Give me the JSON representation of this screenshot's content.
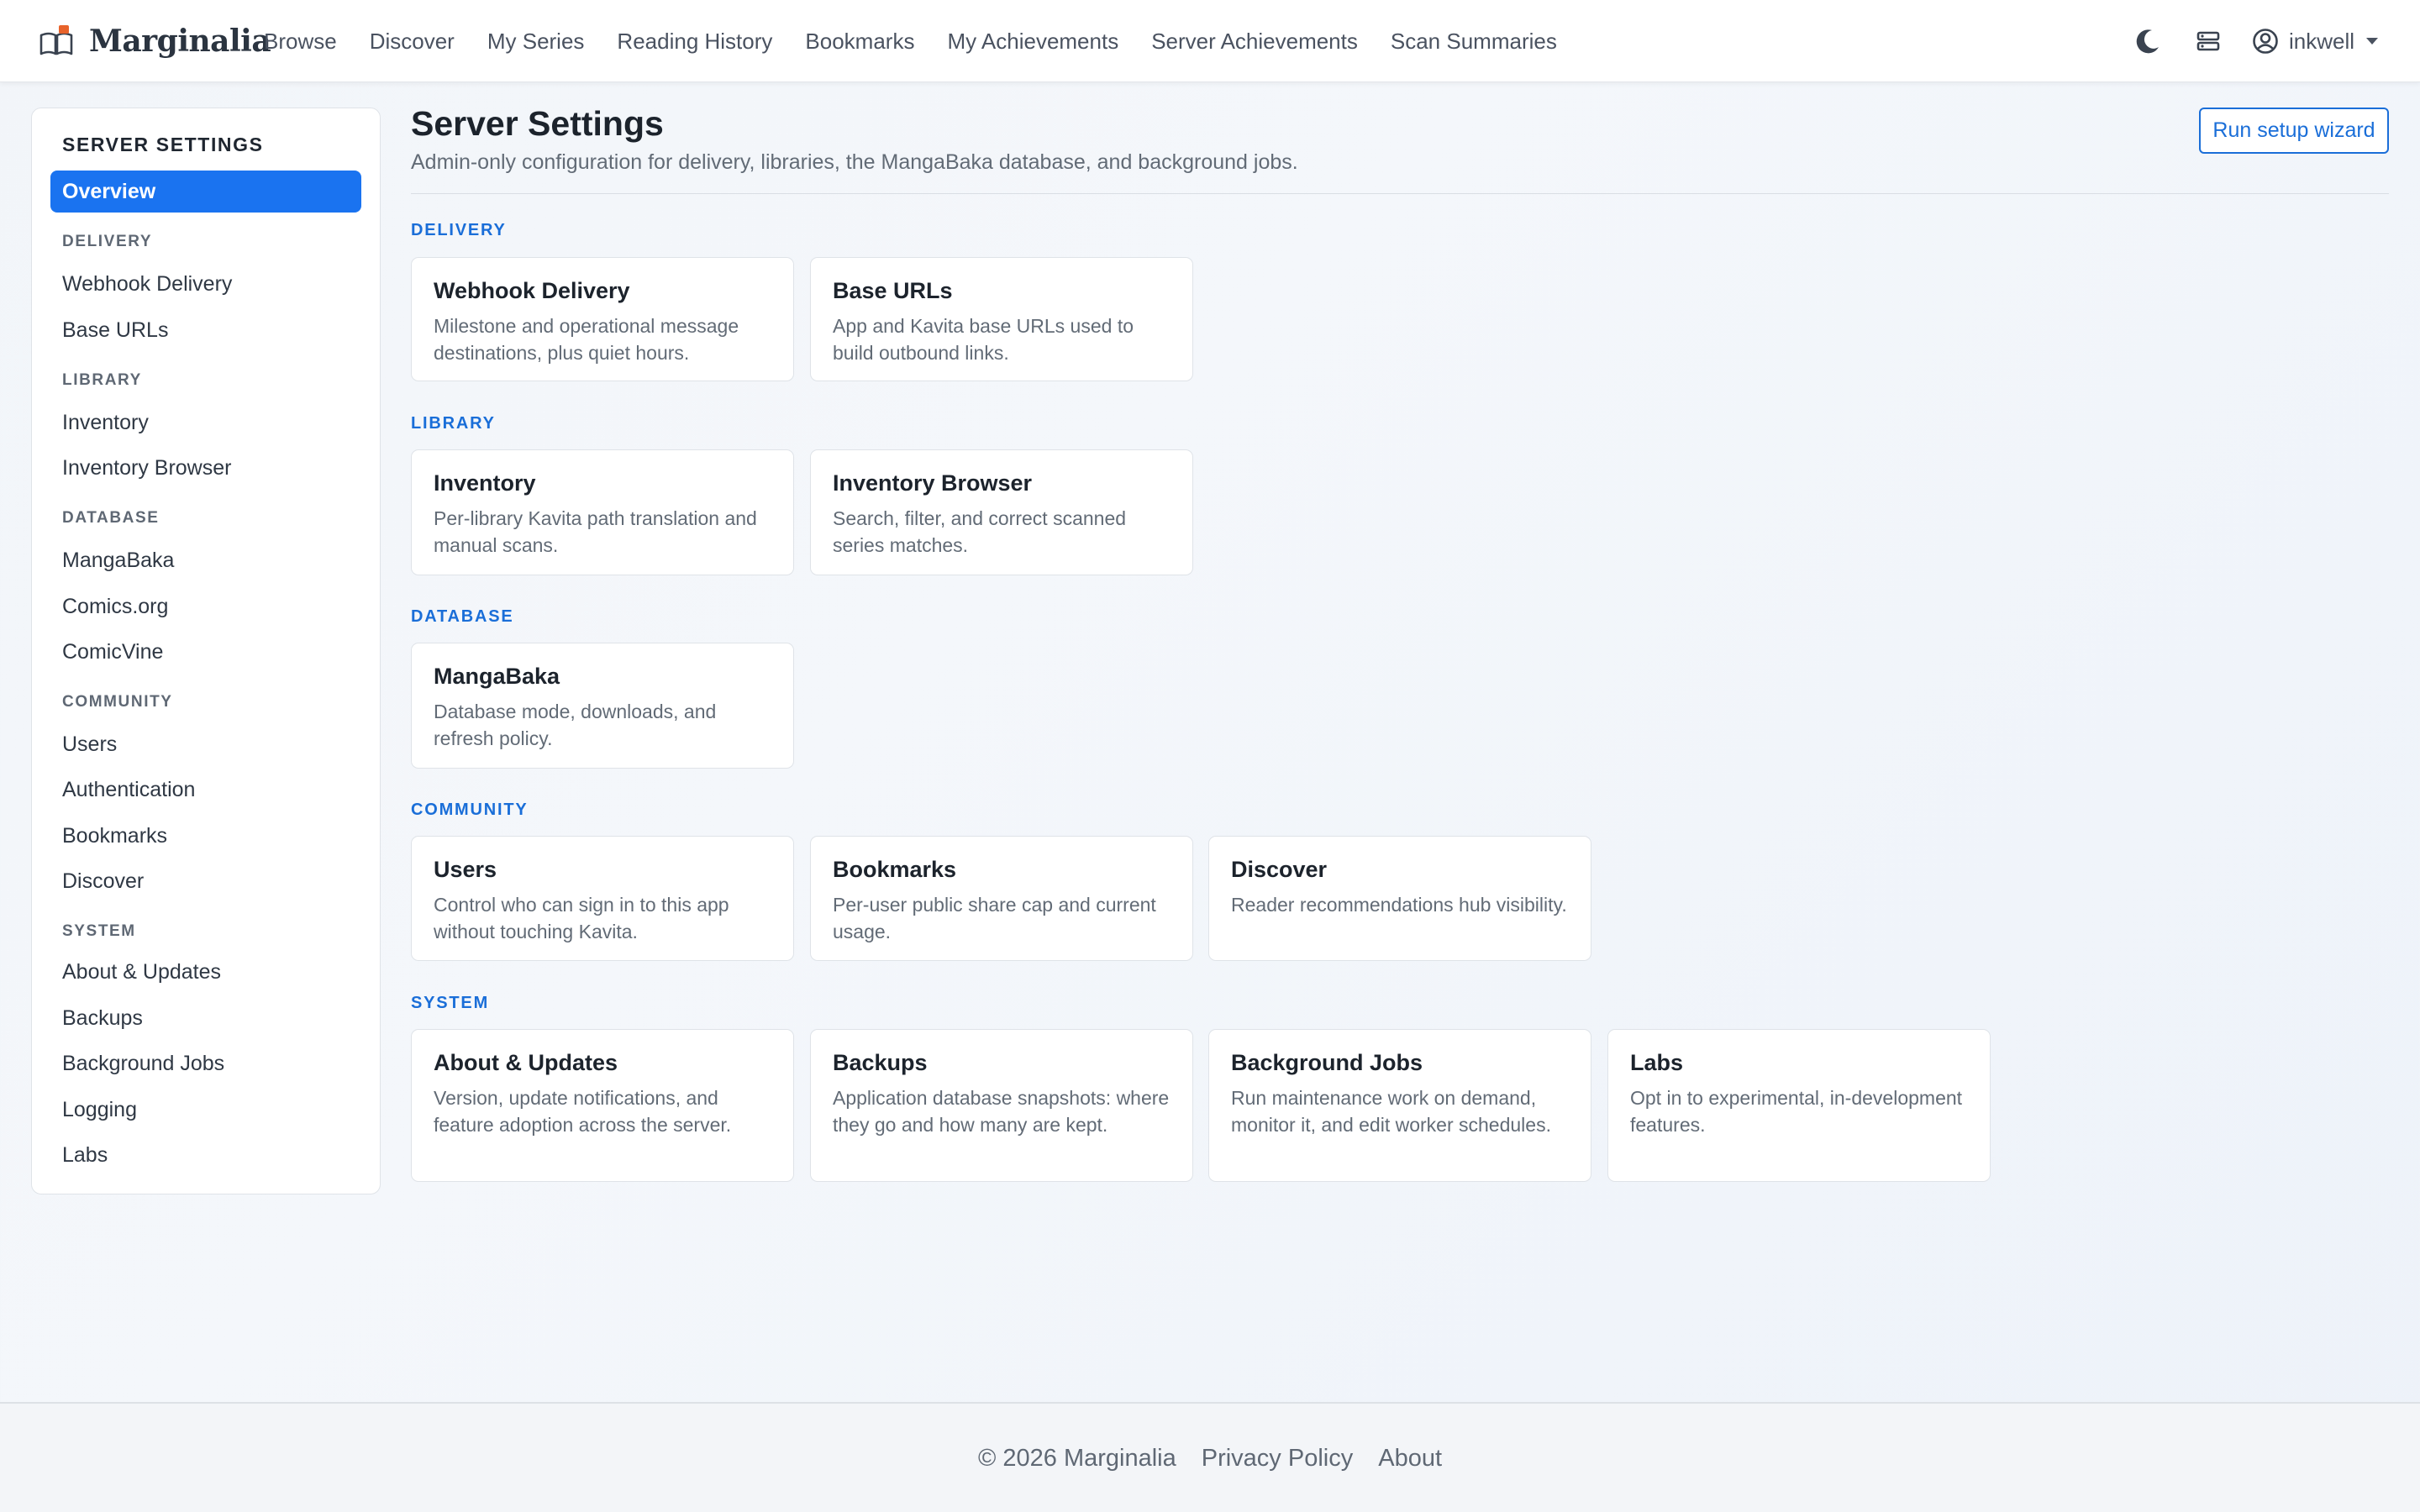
{
  "brand": {
    "name": "Marginalia",
    "icon": "open-book-icon",
    "accent": "#e8632b"
  },
  "nav": {
    "links": [
      "Browse",
      "Discover",
      "My Series",
      "Reading History",
      "Bookmarks",
      "My Achievements",
      "Server Achievements",
      "Scan Summaries"
    ],
    "theme_icon": "moon-icon",
    "server_icon": "server-icon",
    "user": {
      "icon": "user-circle-icon",
      "name": "inkwell"
    }
  },
  "sidebar": {
    "title": "SERVER SETTINGS",
    "active": "Overview",
    "groups": [
      {
        "label": "DELIVERY",
        "items": [
          "Webhook Delivery",
          "Base URLs"
        ]
      },
      {
        "label": "LIBRARY",
        "items": [
          "Inventory",
          "Inventory Browser"
        ]
      },
      {
        "label": "DATABASE",
        "items": [
          "MangaBaka",
          "Comics.org",
          "ComicVine"
        ]
      },
      {
        "label": "COMMUNITY",
        "items": [
          "Users",
          "Authentication",
          "Bookmarks",
          "Discover"
        ]
      },
      {
        "label": "SYSTEM",
        "items": [
          "About & Updates",
          "Backups",
          "Background Jobs",
          "Logging",
          "Labs"
        ]
      }
    ]
  },
  "main": {
    "title": "Server Settings",
    "subtitle": "Admin-only configuration for delivery, libraries, the MangaBaka database, and background jobs.",
    "wizard_button": "Run setup wizard",
    "sections": [
      {
        "label": "DELIVERY",
        "cards": [
          {
            "title": "Webhook Delivery",
            "desc": "Milestone and operational message destinations, plus quiet hours."
          },
          {
            "title": "Base URLs",
            "desc": "App and Kavita base URLs used to build outbound links."
          }
        ]
      },
      {
        "label": "LIBRARY",
        "cards": [
          {
            "title": "Inventory",
            "desc": "Per-library Kavita path translation and manual scans."
          },
          {
            "title": "Inventory Browser",
            "desc": "Search, filter, and correct scanned series matches."
          }
        ]
      },
      {
        "label": "DATABASE",
        "cards": [
          {
            "title": "MangaBaka",
            "desc": "Database mode, downloads, and refresh policy."
          }
        ]
      },
      {
        "label": "COMMUNITY",
        "cards": [
          {
            "title": "Users",
            "desc": "Control who can sign in to this app without touching Kavita."
          },
          {
            "title": "Bookmarks",
            "desc": "Per-user public share cap and current usage."
          },
          {
            "title": "Discover",
            "desc": "Reader recommendations hub visibility."
          }
        ]
      },
      {
        "label": "SYSTEM",
        "cards": [
          {
            "title": "About & Updates",
            "desc": "Version, update notifications, and feature adoption across the server."
          },
          {
            "title": "Backups",
            "desc": "Application database snapshots: where they go and how many are kept."
          },
          {
            "title": "Background Jobs",
            "desc": "Run maintenance work on demand, monitor it, and edit worker schedules."
          },
          {
            "title": "Labs",
            "desc": "Opt in to experimental, in-development features."
          }
        ]
      }
    ]
  },
  "footer": {
    "copyright": "© 2026 Marginalia",
    "links": [
      "Privacy Policy",
      "About"
    ]
  },
  "colors": {
    "primary": "#1a73f0",
    "link": "#1a6ed8"
  }
}
